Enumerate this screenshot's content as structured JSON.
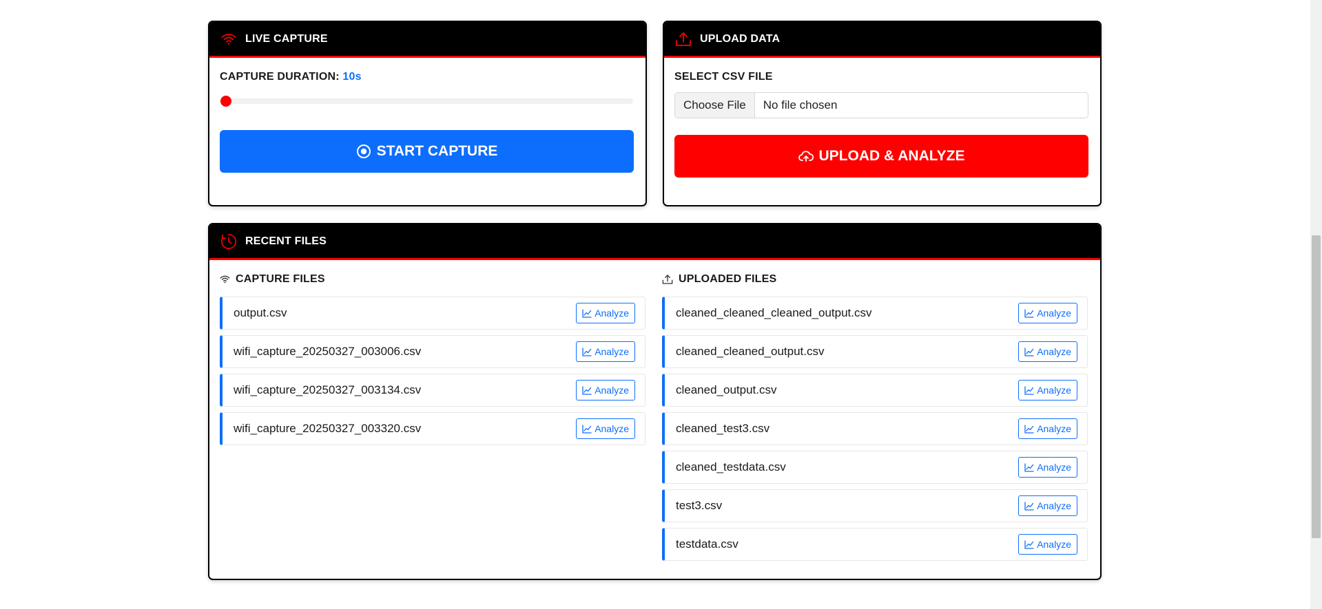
{
  "live_capture": {
    "title": "LIVE CAPTURE",
    "duration_label": "CAPTURE DURATION:",
    "duration_value": "10s",
    "slider_level": 0,
    "start_button": "START CAPTURE"
  },
  "upload_data": {
    "title": "UPLOAD DATA",
    "select_label": "SELECT CSV FILE",
    "choose_button": "Choose File",
    "no_file_text": "No file chosen",
    "upload_button": "UPLOAD & ANALYZE"
  },
  "recent_files": {
    "title": "RECENT FILES",
    "capture_title": "CAPTURE FILES",
    "uploaded_title": "UPLOADED FILES",
    "analyze_label": "Analyze",
    "capture_files": [
      "output.csv",
      "wifi_capture_20250327_003006.csv",
      "wifi_capture_20250327_003134.csv",
      "wifi_capture_20250327_003320.csv"
    ],
    "uploaded_files": [
      "cleaned_cleaned_cleaned_output.csv",
      "cleaned_cleaned_output.csv",
      "cleaned_output.csv",
      "cleaned_test3.csv",
      "cleaned_testdata.csv",
      "test3.csv",
      "testdata.csv"
    ]
  },
  "colors": {
    "accent_blue": "#0d6efd",
    "accent_red": "#ff0000",
    "header_black": "#000000"
  },
  "icons": {
    "live_capture": "wifi-icon",
    "upload_data": "upload-icon",
    "recent_files": "clock-icon",
    "start_capture": "record-icon",
    "upload_analyze": "cloud-upload-icon",
    "analyze": "chart-line-icon"
  }
}
